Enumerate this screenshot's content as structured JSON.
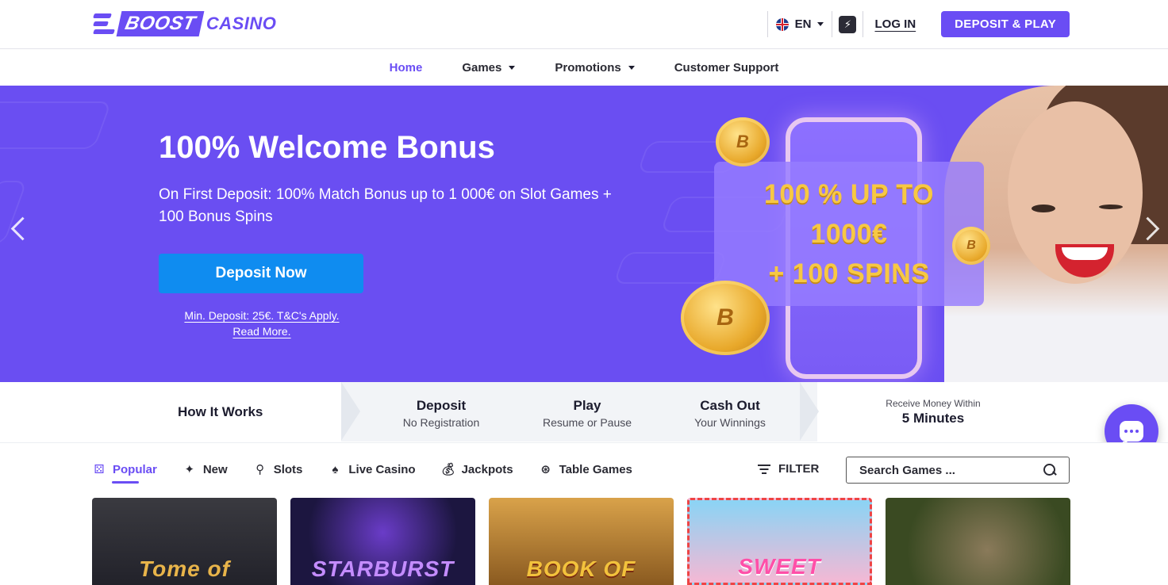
{
  "brand": {
    "logo_word1": "BOOST",
    "logo_word2": "CASINO",
    "accent": "#6a4df4"
  },
  "header": {
    "language": "EN",
    "login_label": "LOG IN",
    "deposit_play_label": "DEPOSIT & PLAY"
  },
  "nav": {
    "items": [
      {
        "label": "Home",
        "active": true,
        "dropdown": false
      },
      {
        "label": "Games",
        "active": false,
        "dropdown": true
      },
      {
        "label": "Promotions",
        "active": false,
        "dropdown": true
      },
      {
        "label": "Customer Support",
        "active": false,
        "dropdown": false
      }
    ]
  },
  "hero": {
    "title": "100% Welcome Bonus",
    "subtitle": "On First Deposit: 100% Match Bonus up to 1 000€ on Slot Games + 100 Bonus Spins",
    "cta_label": "Deposit Now",
    "terms_line1": "Min. Deposit: 25€. T&C's Apply.",
    "terms_line2": "Read More.",
    "promo_lines": [
      "100 % UP TO",
      "1000€",
      "+ 100 SPINS"
    ],
    "background": "#6a4ef2"
  },
  "how_it_works": {
    "title": "How It Works",
    "steps": [
      {
        "title": "Deposit",
        "subtitle": "No Registration"
      },
      {
        "title": "Play",
        "subtitle": "Resume or Pause"
      },
      {
        "title": "Cash Out",
        "subtitle": "Your Winnings"
      }
    ],
    "receive_label": "Receive Money Within",
    "receive_value": "5 Minutes"
  },
  "categories": {
    "items": [
      {
        "label": "Popular",
        "icon": "dice-icon",
        "active": true
      },
      {
        "label": "New",
        "icon": "sparkle-icon",
        "active": false
      },
      {
        "label": "Slots",
        "icon": "slot-lever-icon",
        "active": false
      },
      {
        "label": "Live Casino",
        "icon": "spade-icon",
        "active": false
      },
      {
        "label": "Jackpots",
        "icon": "money-bag-icon",
        "active": false
      },
      {
        "label": "Table Games",
        "icon": "chip-icon",
        "active": false
      }
    ],
    "filter_label": "FILTER",
    "search_placeholder": "Search Games ..."
  },
  "games": [
    {
      "name": "Tome of",
      "bg": "#2a2a2e",
      "fg": "#e8b44a"
    },
    {
      "name": "STARBURST",
      "bg": "#1c1640",
      "fg": "#b06cff"
    },
    {
      "name": "BOOK OF",
      "bg": "#c28a3a",
      "fg": "#f2c23c"
    },
    {
      "name": "SWEET",
      "bg": "#6fc8f0",
      "fg": "#ff4fa8"
    },
    {
      "name": "",
      "bg": "#4a5a2a",
      "fg": "#ffffff"
    }
  ]
}
